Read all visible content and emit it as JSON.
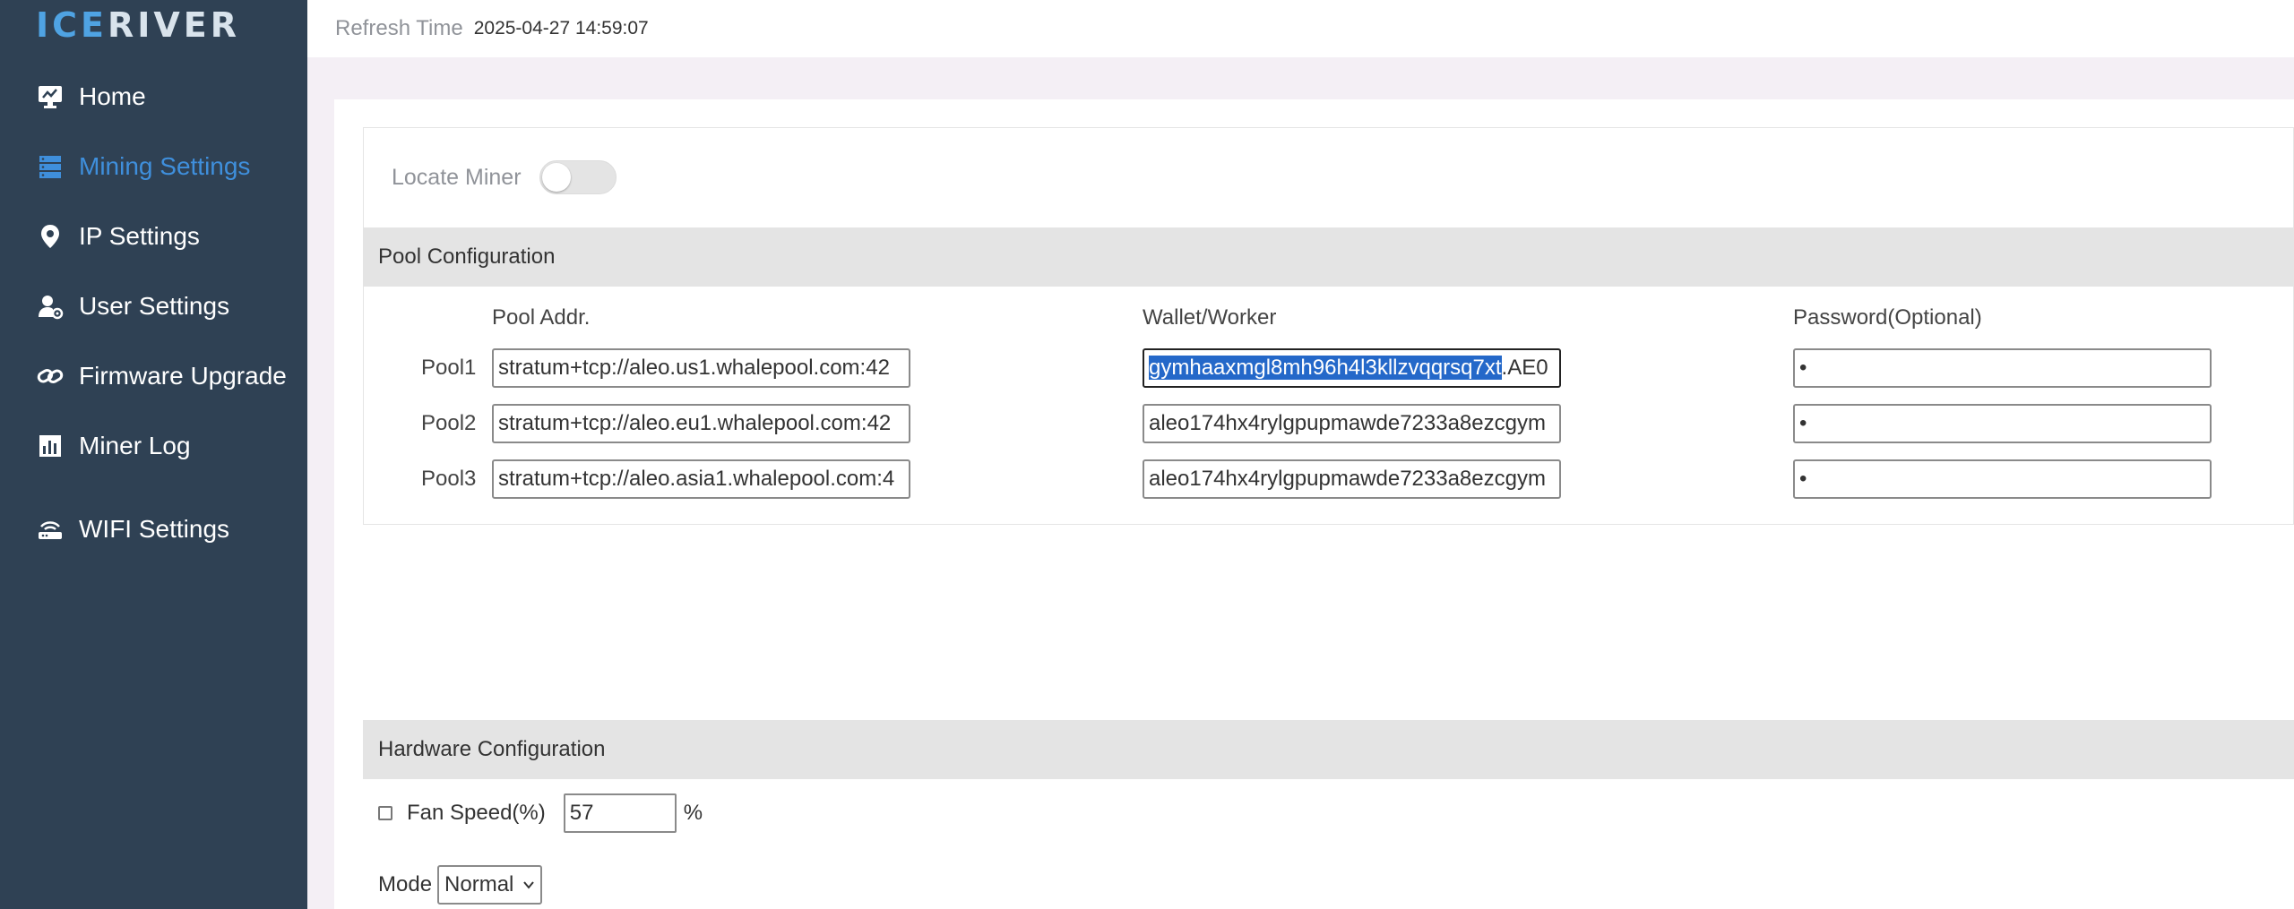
{
  "brand": {
    "part1": "ICE",
    "part2": "RIVER"
  },
  "sidebar": {
    "items": [
      {
        "label": "Home",
        "icon": "monitor-icon",
        "active": false
      },
      {
        "label": "Mining Settings",
        "icon": "server-icon",
        "active": true
      },
      {
        "label": "IP Settings",
        "icon": "location-pin-icon",
        "active": false
      },
      {
        "label": "User Settings",
        "icon": "user-gear-icon",
        "active": false
      },
      {
        "label": "Firmware Upgrade",
        "icon": "link-icon",
        "active": false
      },
      {
        "label": "Miner Log",
        "icon": "chart-icon",
        "active": false
      },
      {
        "label": "WIFI Settings",
        "icon": "router-icon",
        "active": false
      }
    ]
  },
  "header": {
    "refresh_label": "Refresh Time",
    "refresh_value": "2025-04-27 14:59:07"
  },
  "locate": {
    "label": "Locate Miner",
    "enabled": false
  },
  "pool_config": {
    "title": "Pool Configuration",
    "columns": {
      "addr": "Pool Addr.",
      "wallet": "Wallet/Worker",
      "password": "Password(Optional)"
    },
    "pools": [
      {
        "label": "Pool1",
        "addr": "stratum+tcp://aleo.us1.whalepool.com:42",
        "wallet_selected": "gymhaaxmgl8mh96h4l3kllzvqqrsq7xt",
        "wallet_rest": ".AE0",
        "password": "•"
      },
      {
        "label": "Pool2",
        "addr": "stratum+tcp://aleo.eu1.whalepool.com:42",
        "wallet": "aleo174hx4rylgpupmawde7233a8ezcgym",
        "password": "•"
      },
      {
        "label": "Pool3",
        "addr": "stratum+tcp://aleo.asia1.whalepool.com:4",
        "wallet": "aleo174hx4rylgpupmawde7233a8ezcgym",
        "password": "•"
      }
    ]
  },
  "hardware": {
    "title": "Hardware Configuration",
    "fan_label": "Fan Speed(%)",
    "fan_value": "57",
    "fan_unit": "%",
    "mode_label": "Mode",
    "mode_value": "Normal"
  },
  "colors": {
    "sidebar_bg": "#2f4154",
    "accent": "#3f8fdc",
    "selection": "#2468c9"
  }
}
